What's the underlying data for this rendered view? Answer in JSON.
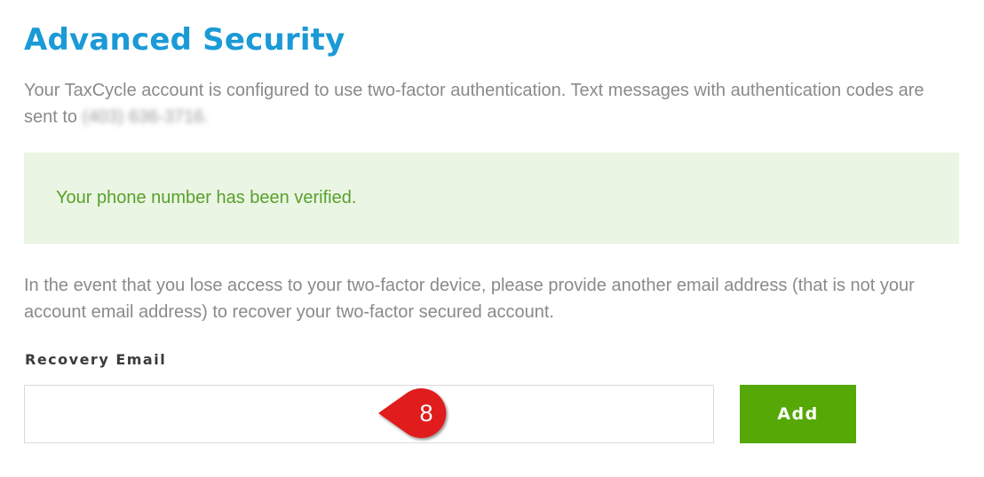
{
  "page": {
    "title": "Advanced Security",
    "intro_text": "Your TaxCycle account is configured to use two-factor authentication. Text messages with authentication codes are sent to ",
    "masked_phone": "(403) 636-3716."
  },
  "alert": {
    "message": "Your phone number has been verified."
  },
  "recovery": {
    "description": "In the event that you lose access to your two-factor device, please provide another email address (that is not your account email address) to recover your two-factor secured account.",
    "field_label": "Recovery Email",
    "email_value": "",
    "placeholder": "",
    "add_button_label": "Add"
  },
  "annotation": {
    "callout_number": "8",
    "callout_color": "#e01b1b"
  },
  "colors": {
    "title": "#1a9ad6",
    "body_text": "#8a8a8a",
    "alert_bg": "#ebf5e3",
    "alert_text": "#57a12c",
    "button_bg": "#55a805"
  }
}
